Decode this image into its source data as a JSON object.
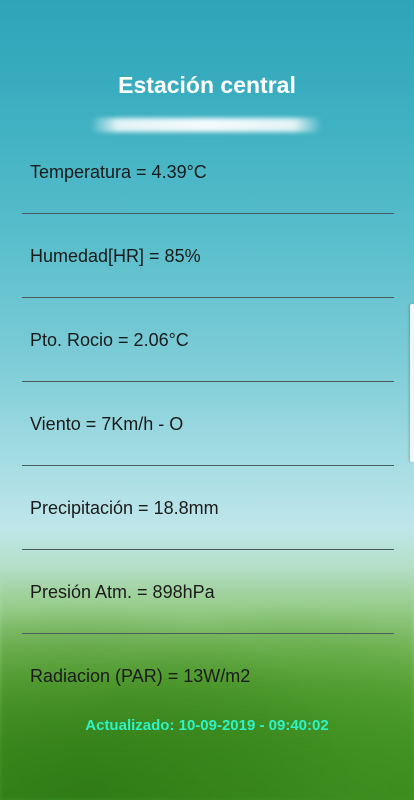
{
  "screen": {
    "title": "Estación central",
    "updated": "Actualizado: 10-09-2019 - 09:40:02",
    "colors": {
      "title": "#ffffff",
      "row_text": "#1b1b1b",
      "divider": "#4a5b5e",
      "updated_text": "#2ef3c6"
    }
  },
  "rows": [
    {
      "text": "Temperatura = 4.39°C"
    },
    {
      "text": "Humedad[HR] = 85%"
    },
    {
      "text": "Pto. Rocio = 2.06°C"
    },
    {
      "text": "Viento = 7Km/h - O"
    },
    {
      "text": "Precipitación = 18.8mm"
    },
    {
      "text": "Presión Atm. = 898hPa"
    },
    {
      "text": "Radiacion (PAR) = 13W/m2"
    }
  ]
}
